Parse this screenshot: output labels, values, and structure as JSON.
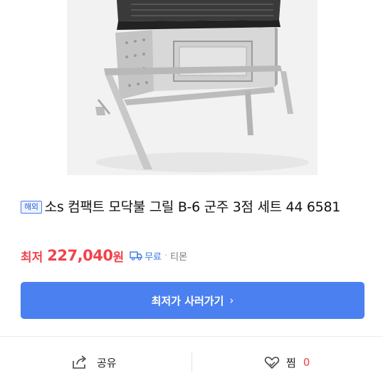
{
  "product": {
    "badge": "해외",
    "title": "소s 컴팩트 모닥불 그릴 B-6 군주 3점 세트 44 6581"
  },
  "price": {
    "label": "최저",
    "value": "227,040",
    "unit": "원",
    "shipping": "무료",
    "seller": "티몬"
  },
  "cta": {
    "label": "최저가 사러가기",
    "chevron": "›"
  },
  "actions": {
    "share_label": "공유",
    "wish_label": "찜",
    "wish_count": "0"
  },
  "icons": {
    "zoom": "magnifier-icon",
    "shipping": "truck-icon",
    "share": "share-icon",
    "wish": "heart-icon"
  },
  "colors": {
    "accent": "#4a80f0",
    "price": "#f2424b",
    "shipping": "#3a78e8"
  }
}
